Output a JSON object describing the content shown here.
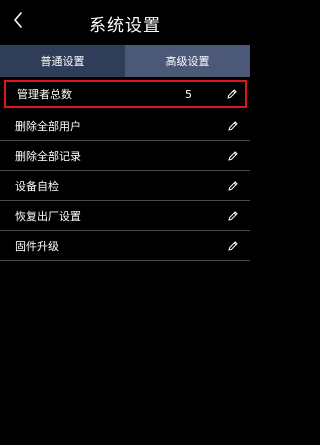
{
  "header": {
    "title": "系统设置",
    "back_icon": "chevron-left-icon"
  },
  "tabs": [
    {
      "label": "普通设置",
      "active": false
    },
    {
      "label": "高级设置",
      "active": true
    }
  ],
  "colors": {
    "background": "#000000",
    "tab_normal": "#2f3d58",
    "tab_active": "#4b5878",
    "highlight_border": "#e0161f",
    "divider": "#4a4a4a",
    "text": "#ffffff"
  },
  "items": [
    {
      "label": "管理者总数",
      "value": "5",
      "icon": "pencil-icon",
      "selected": true
    },
    {
      "label": "删除全部用户",
      "value": "",
      "icon": "pencil-icon",
      "selected": false
    },
    {
      "label": "删除全部记录",
      "value": "",
      "icon": "pencil-icon",
      "selected": false
    },
    {
      "label": "设备自检",
      "value": "",
      "icon": "pencil-icon",
      "selected": false
    },
    {
      "label": "恢复出厂设置",
      "value": "",
      "icon": "pencil-icon",
      "selected": false
    },
    {
      "label": "固件升级",
      "value": "",
      "icon": "pencil-icon",
      "selected": false
    }
  ]
}
